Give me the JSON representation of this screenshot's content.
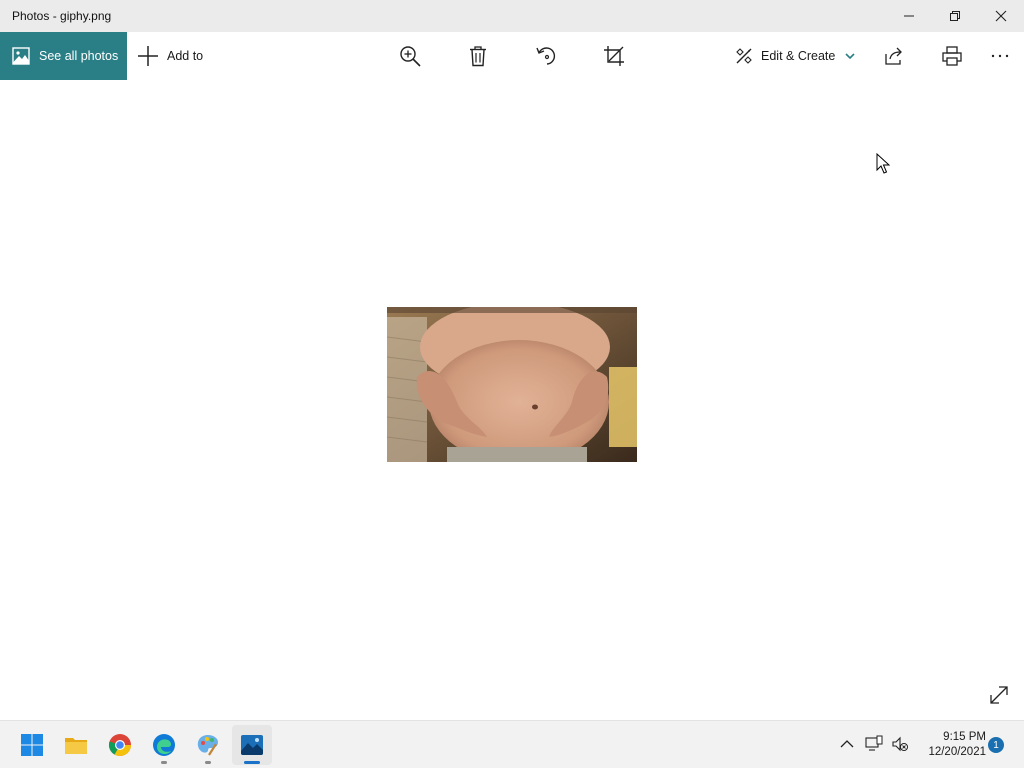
{
  "window": {
    "title": "Photos - giphy.png",
    "minimize_icon": "minimize-icon",
    "maximize_icon": "restore-icon",
    "close_icon": "close-icon"
  },
  "toolbar": {
    "see_all_label": "See all photos",
    "add_to_label": "Add to",
    "edit_create_label": "Edit & Create",
    "accent_color": "#2a7f86",
    "icons": [
      "zoom-in-icon",
      "delete-icon",
      "rotate-icon",
      "crop-icon",
      "share-icon",
      "print-icon",
      "more-icon"
    ]
  },
  "image": {
    "filename": "giphy.png"
  },
  "taskbar": {
    "apps": [
      "start",
      "file-explorer",
      "chrome",
      "edge",
      "paint",
      "photos"
    ],
    "active_app": "photos",
    "time": "9:15 PM",
    "date": "12/20/2021",
    "notification_count": "1"
  }
}
